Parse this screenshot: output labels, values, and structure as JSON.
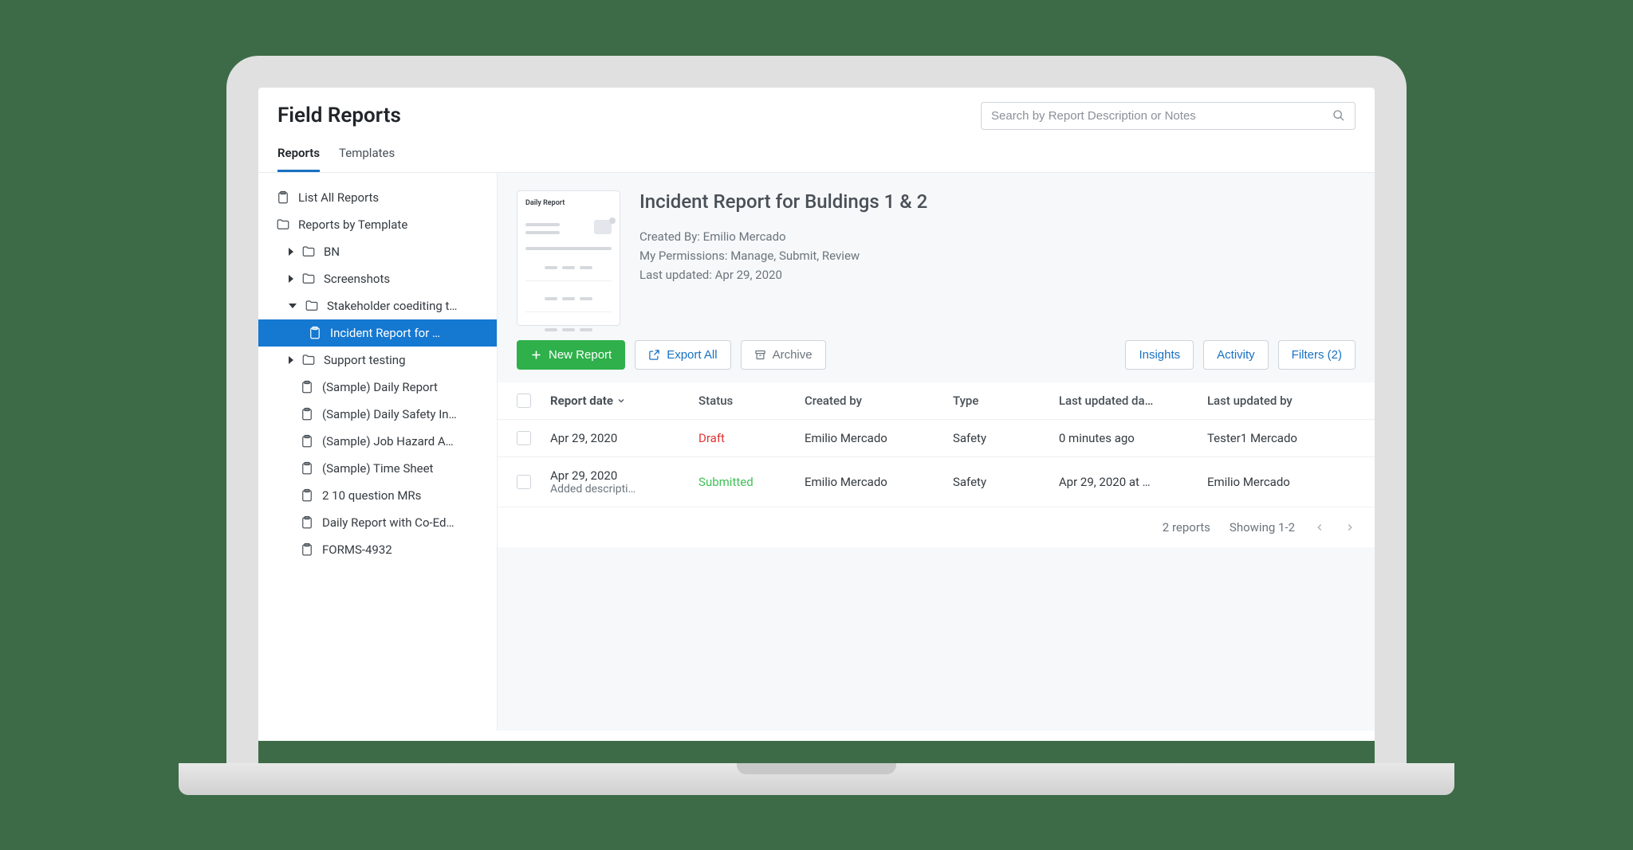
{
  "header": {
    "title": "Field Reports",
    "search_placeholder": "Search by Report Description or Notes"
  },
  "tabs": [
    {
      "label": "Reports",
      "active": true
    },
    {
      "label": "Templates",
      "active": false
    }
  ],
  "sidebar": {
    "list_all": "List All Reports",
    "by_template": "Reports by Template",
    "folders": {
      "bn": "BN",
      "screenshots": "Screenshots",
      "stakeholder": "Stakeholder coediting t…",
      "support": "Support testing"
    },
    "selected_report": "Incident Report for …",
    "samples": {
      "daily": "(Sample) Daily Report",
      "safety": "(Sample) Daily Safety In…",
      "hazard": "(Sample) Job Hazard A…",
      "timesheet": "(Sample) Time Sheet",
      "mrs": "2 10 question MRs",
      "coedit": "Daily Report with Co-Ed…",
      "forms": "FORMS-4932"
    }
  },
  "detail": {
    "thumb_title": "Daily Report",
    "title": "Incident Report for Buldings 1 & 2",
    "created_by_label": "Created By:",
    "created_by_value": "Emilio Mercado",
    "permissions_label": "My Permissions:",
    "permissions_value": "Manage, Submit, Review",
    "updated_label": "Last updated:",
    "updated_value": "Apr 29, 2020"
  },
  "toolbar": {
    "new_report": "New Report",
    "export_all": "Export All",
    "archive": "Archive",
    "insights": "Insights",
    "activity": "Activity",
    "filters": "Filters (2)"
  },
  "table": {
    "columns": {
      "date": "Report date",
      "status": "Status",
      "created_by": "Created by",
      "type": "Type",
      "updated_date": "Last updated da…",
      "updated_by": "Last updated by"
    },
    "rows": [
      {
        "date": "Apr 29, 2020",
        "desc": "",
        "status": "Draft",
        "status_class": "status-draft",
        "created_by": "Emilio Mercado",
        "type": "Safety",
        "updated_date": "0 minutes ago",
        "updated_by": "Tester1 Mercado"
      },
      {
        "date": "Apr 29, 2020",
        "desc": "Added descripti…",
        "status": "Submitted",
        "status_class": "status-submitted",
        "created_by": "Emilio Mercado",
        "type": "Safety",
        "updated_date": "Apr 29, 2020 at …",
        "updated_by": "Emilio Mercado"
      }
    ],
    "footer": {
      "count": "2 reports",
      "showing": "Showing 1-2"
    }
  }
}
